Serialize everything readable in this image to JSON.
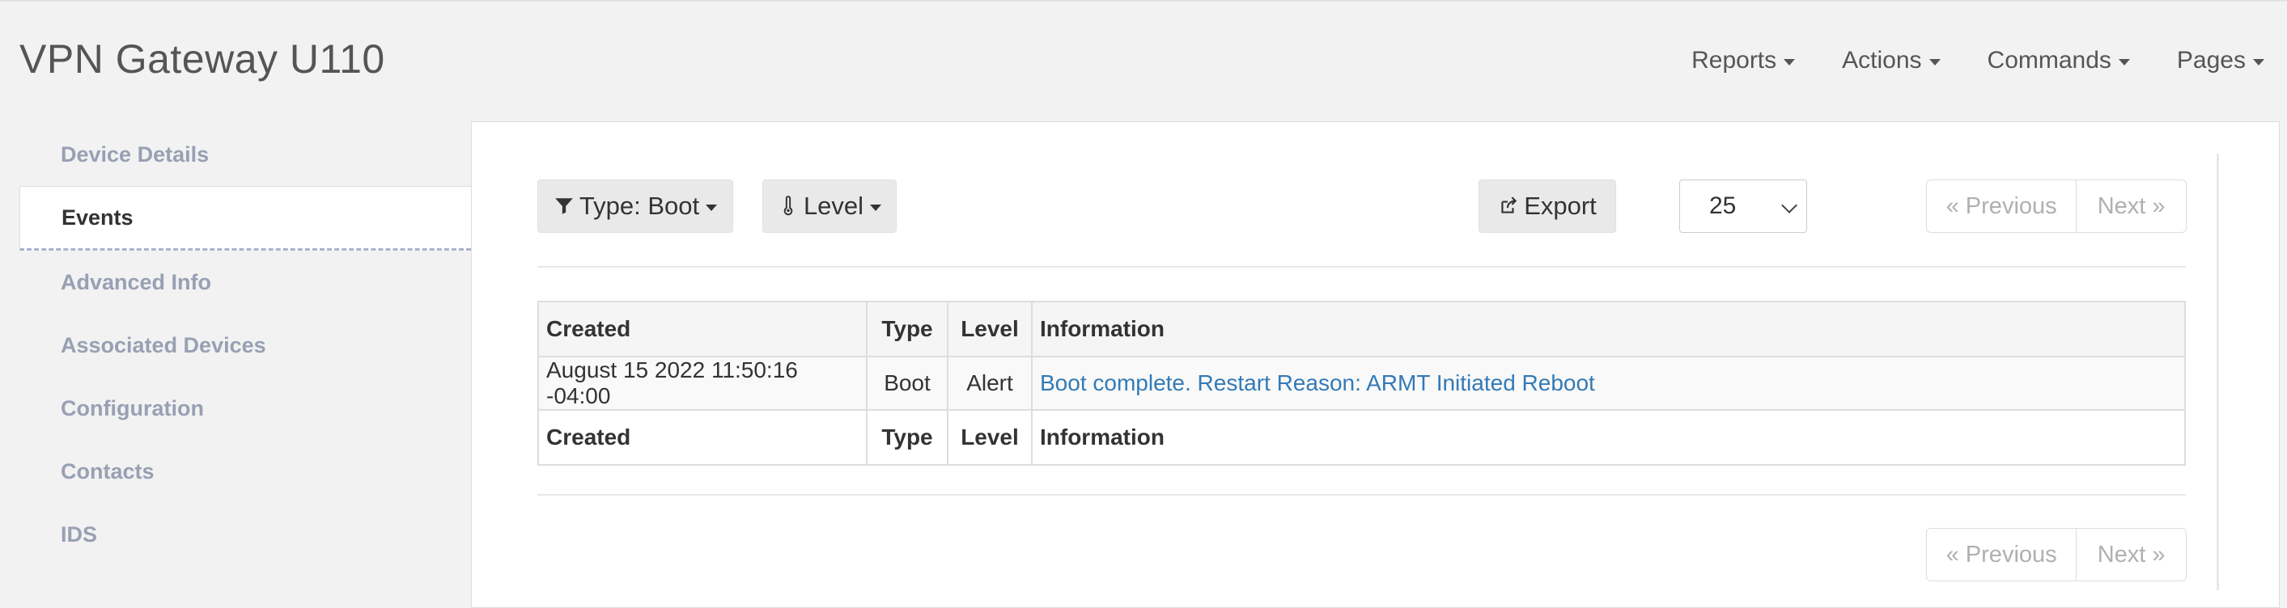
{
  "app": {
    "title": "VPN Gateway U110"
  },
  "topnav": [
    {
      "label": "Reports"
    },
    {
      "label": "Actions"
    },
    {
      "label": "Commands"
    },
    {
      "label": "Pages"
    }
  ],
  "sidebar": {
    "items": [
      {
        "label": "Device Details"
      },
      {
        "label": "Events",
        "active": true
      },
      {
        "label": "Advanced Info"
      },
      {
        "label": "Associated Devices"
      },
      {
        "label": "Configuration"
      },
      {
        "label": "Contacts"
      },
      {
        "label": "IDS"
      }
    ]
  },
  "toolbar": {
    "type_filter": "Type: Boot",
    "level_filter": "Level",
    "export": "Export",
    "page_size": "25"
  },
  "pagination": {
    "previous": "« Previous",
    "next": "Next »"
  },
  "table": {
    "columns": [
      "Created",
      "Type",
      "Level",
      "Information"
    ],
    "rows": [
      {
        "created": "August 15 2022 11:50:16 -04:00",
        "type": "Boot",
        "level": "Alert",
        "information": "Boot complete. Restart Reason: ARMT Initiated Reboot"
      }
    ]
  },
  "icons": {
    "type_filter": "filter-icon",
    "level_filter": "thermometer-icon",
    "export": "share-square-icon"
  },
  "colors": {
    "link": "#337ab7",
    "sidebar_text": "#98a0b3",
    "background": "#f2f2f2"
  }
}
